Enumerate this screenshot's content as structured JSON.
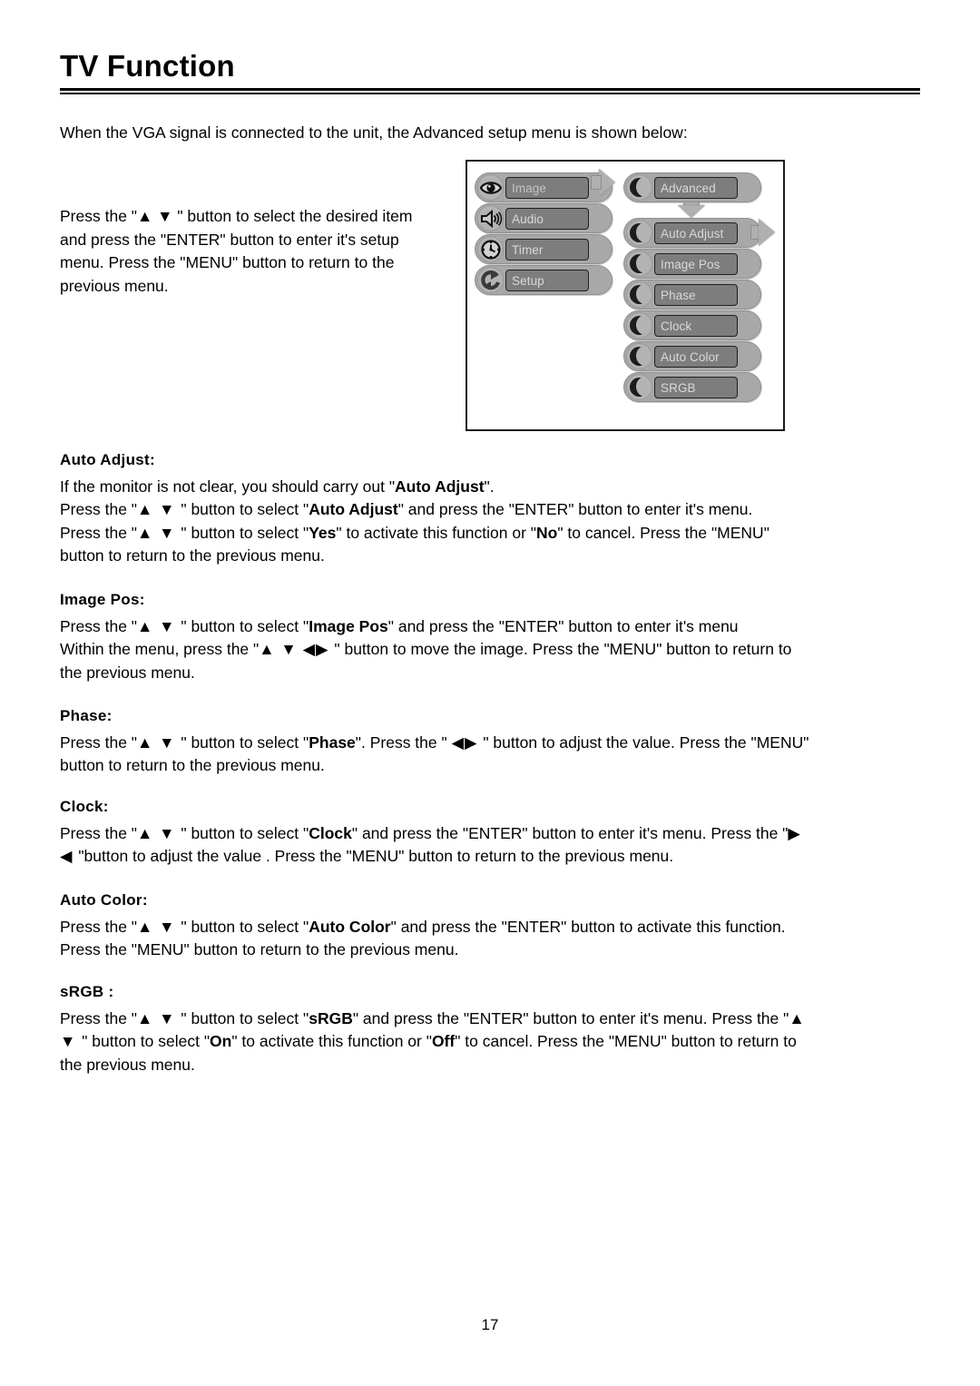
{
  "document": {
    "title": "TV Function",
    "page_number": "17",
    "intro": "When the VGA signal is connected to the unit, the Advanced setup menu is shown below:",
    "left_paragraph": "Press the \"▲ ▼ \" button to select the desired item and press the \"ENTER\" button to enter it's setup menu. Press the \"MENU\" button to return to the previous menu."
  },
  "diagram": {
    "left_column": [
      {
        "label": "Image",
        "icon": "eye-icon"
      },
      {
        "label": "Audio",
        "icon": "speaker-icon"
      },
      {
        "label": "Timer",
        "icon": "clock-icon"
      },
      {
        "label": "Setup",
        "icon": "refresh-icon"
      }
    ],
    "right_column_header": {
      "label": "Advanced",
      "icon": "crescent-icon"
    },
    "right_column": [
      {
        "label": "Auto Adjust",
        "icon": "crescent-icon"
      },
      {
        "label": "Image Pos",
        "icon": "crescent-icon"
      },
      {
        "label": "Phase",
        "icon": "crescent-icon"
      },
      {
        "label": "Clock",
        "icon": "crescent-icon"
      },
      {
        "label": "Auto Color",
        "icon": "crescent-icon"
      },
      {
        "label": "SRGB",
        "icon": "crescent-icon"
      }
    ],
    "connectors": [
      {
        "name": "image-to-advanced-arrow",
        "direction": "right"
      },
      {
        "name": "advanced-to-auto-adjust-arrow",
        "direction": "down"
      },
      {
        "name": "auto-adjust-next-arrow",
        "direction": "right"
      }
    ]
  },
  "sections": [
    {
      "id": "auto-adjust",
      "heading": "Auto Adjust:",
      "lines": [
        "If the monitor is not clear, you should carry out \"Auto Adjust\".",
        "Press the \"▲ ▼ \" button to select \"Auto Adjust\" and press the \"ENTER\" button to enter it's menu.",
        "Press the \"▲ ▼ \" button to select \"Yes\" to activate this function or \"No\" to cancel. Press the \"MENU\" button to return to the previous menu."
      ]
    },
    {
      "id": "image-pos",
      "heading": "Image Pos:",
      "lines": [
        "Press the \"▲ ▼ \" button to select \"Image Pos\" and press the \"ENTER\" button to enter it's menu",
        "Within the menu, press the \"▲ ▼ ◀▶ \" button to move the image. Press the \"MENU\" button to return to the previous menu."
      ]
    },
    {
      "id": "phase",
      "heading": "Phase:",
      "lines": [
        "Press the \"▲ ▼ \" button to select \"Phase\". Press the \" ◀▶ \" button to adjust the value. Press the \"MENU\" button to return to the previous menu."
      ]
    },
    {
      "id": "clock",
      "heading": "Clock:",
      "lines": [
        "Press the \"▲ ▼ \" button to select \"Clock\" and press the \"ENTER\" button to enter it's menu. Press the \"▶ ◀ \"button to adjust the value . Press the \"MENU\" button to return to the previous menu."
      ]
    },
    {
      "id": "auto-color",
      "heading": "Auto Color:",
      "lines": [
        "Press the \"▲ ▼ \" button to select \"Auto Color\" and press the \"ENTER\" button to activate this function. Press the \"MENU\" button to return to the previous menu."
      ]
    },
    {
      "id": "srgb",
      "heading": "sRGB :",
      "lines": [
        "Press the \"▲ ▼ \" button to select \"sRGB\" and press the \"ENTER\" button to enter it's menu. Press the \"▲ ▼ \" button to select \"On\" to activate this function or \"Off\" to cancel. Press the \"MENU\" button to return to the previous menu."
      ]
    }
  ],
  "colors": {
    "pill_outer": "#a8a8a8",
    "pill_inner": "#7d7d7d",
    "pill_text": "#d9d9d9",
    "arrow": "#b0b0b0",
    "frame": "#1a1a1a"
  }
}
